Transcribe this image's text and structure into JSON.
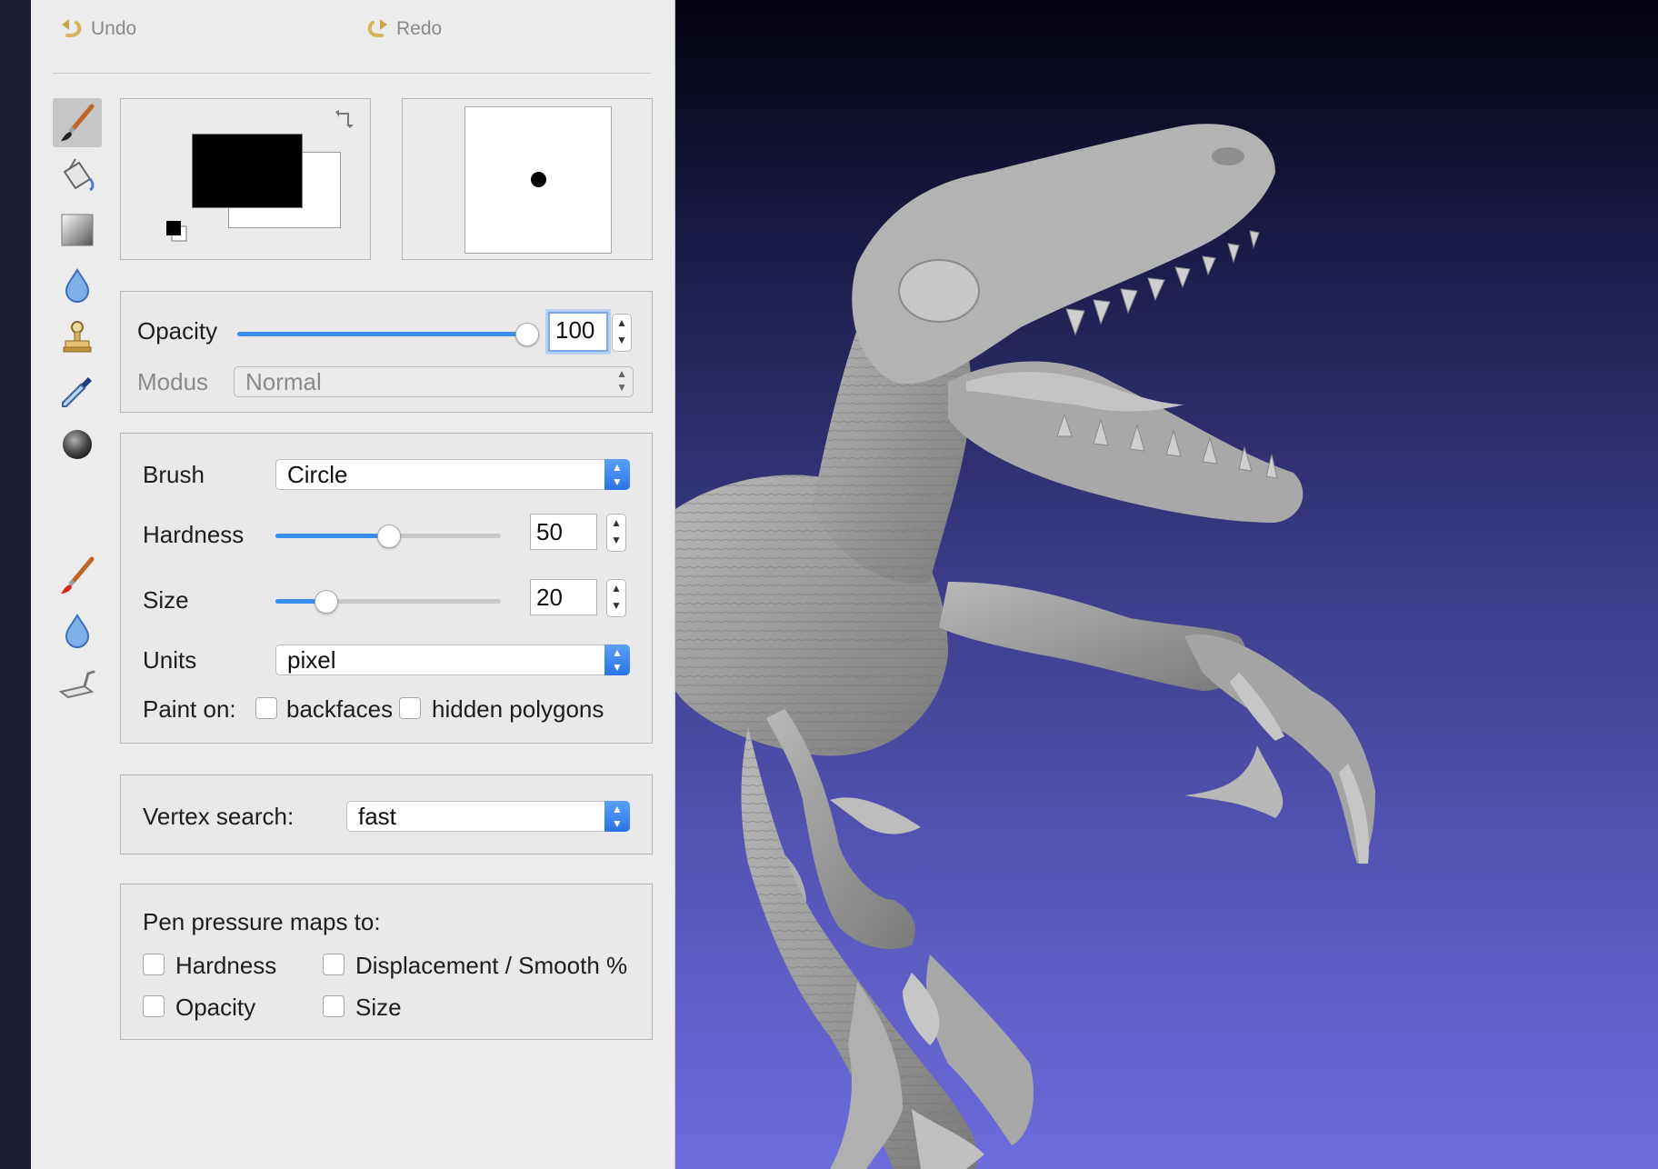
{
  "toolbar": {
    "undo_label": "Undo",
    "redo_label": "Redo"
  },
  "tools": [
    {
      "name": "paint-brush-tool",
      "active": true
    },
    {
      "name": "fill-bucket-tool",
      "active": false
    },
    {
      "name": "gradient-tool",
      "active": false
    },
    {
      "name": "smooth-drop-tool",
      "active": false
    },
    {
      "name": "clone-stamp-tool",
      "active": false
    },
    {
      "name": "color-picker-tool",
      "active": false
    },
    {
      "name": "sphere-tool",
      "active": false
    },
    {
      "name": "noise-brush-tool",
      "active": false
    },
    {
      "name": "displace-drop-tool",
      "active": false
    },
    {
      "name": "scrape-tool",
      "active": false
    }
  ],
  "colors": {
    "foreground": "#000000",
    "background": "#ffffff",
    "accent": "#3b8cf0"
  },
  "opacity": {
    "label": "Opacity",
    "value": "100",
    "fraction": 1.0
  },
  "mode": {
    "label": "Modus",
    "value": "Normal"
  },
  "brush": {
    "brush_label": "Brush",
    "brush_value": "Circle",
    "hardness_label": "Hardness",
    "hardness_value": "50",
    "hardness_fraction": 0.5,
    "size_label": "Size",
    "size_value": "20",
    "size_fraction": 0.22,
    "units_label": "Units",
    "units_value": "pixel",
    "paint_on_label": "Paint on:",
    "backfaces_label": "backfaces",
    "hidden_polygons_label": "hidden polygons"
  },
  "vertex_search": {
    "label": "Vertex search:",
    "value": "fast"
  },
  "pen_pressure": {
    "title": "Pen pressure maps to:",
    "hardness_label": "Hardness",
    "displacement_label": "Displacement / Smooth %",
    "opacity_label": "Opacity",
    "size_label": "Size"
  }
}
